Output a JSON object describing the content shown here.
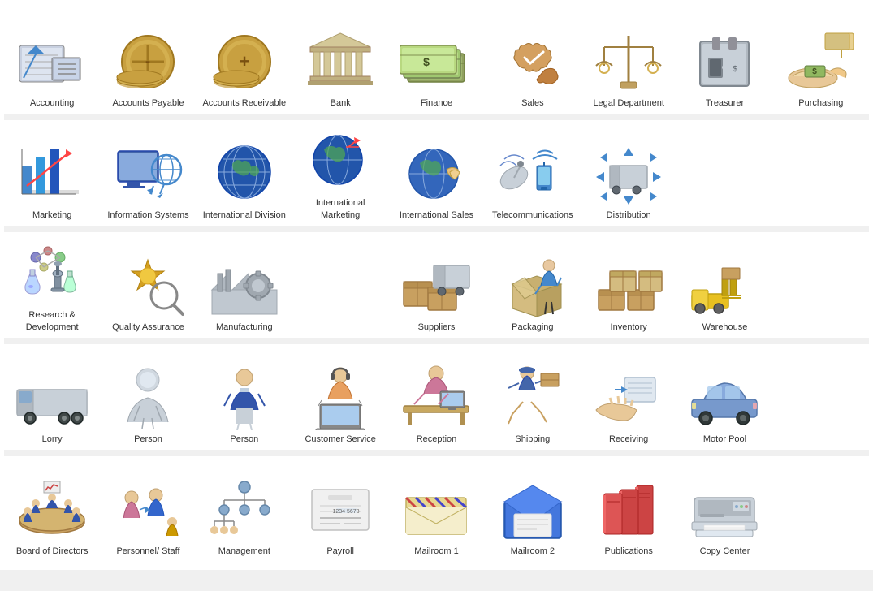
{
  "items": [
    {
      "id": "accounting",
      "label": "Accounting",
      "row": 1
    },
    {
      "id": "accounts-payable",
      "label": "Accounts Payable",
      "row": 1
    },
    {
      "id": "accounts-receivable",
      "label": "Accounts Receivable",
      "row": 1
    },
    {
      "id": "bank",
      "label": "Bank",
      "row": 1
    },
    {
      "id": "finance",
      "label": "Finance",
      "row": 1
    },
    {
      "id": "sales",
      "label": "Sales",
      "row": 1
    },
    {
      "id": "legal-department",
      "label": "Legal Department",
      "row": 1
    },
    {
      "id": "treasurer",
      "label": "Treasurer",
      "row": 1
    },
    {
      "id": "purchasing",
      "label": "Purchasing",
      "row": 1
    },
    {
      "id": "marketing",
      "label": "Marketing",
      "row": 2
    },
    {
      "id": "information-systems",
      "label": "Information Systems",
      "row": 2
    },
    {
      "id": "international-division",
      "label": "International Division",
      "row": 2
    },
    {
      "id": "international-marketing",
      "label": "International Marketing",
      "row": 2
    },
    {
      "id": "international-sales",
      "label": "International Sales",
      "row": 2
    },
    {
      "id": "telecommunications",
      "label": "Telecommunications",
      "row": 2
    },
    {
      "id": "distribution",
      "label": "Distribution",
      "row": 2
    },
    {
      "id": "empty1",
      "label": "",
      "row": 2
    },
    {
      "id": "empty2",
      "label": "",
      "row": 2
    },
    {
      "id": "research-development",
      "label": "Research & Development",
      "row": 3
    },
    {
      "id": "quality-assurance",
      "label": "Quality Assurance",
      "row": 3
    },
    {
      "id": "manufacturing",
      "label": "Manufacturing",
      "row": 3
    },
    {
      "id": "empty3",
      "label": "",
      "row": 3
    },
    {
      "id": "suppliers",
      "label": "Suppliers",
      "row": 3
    },
    {
      "id": "packaging",
      "label": "Packaging",
      "row": 3
    },
    {
      "id": "inventory",
      "label": "Inventory",
      "row": 3
    },
    {
      "id": "warehouse",
      "label": "Warehouse",
      "row": 3
    },
    {
      "id": "empty4",
      "label": "",
      "row": 3
    },
    {
      "id": "lorry",
      "label": "Lorry",
      "row": 4
    },
    {
      "id": "person1",
      "label": "Person",
      "row": 4
    },
    {
      "id": "person2",
      "label": "Person",
      "row": 4
    },
    {
      "id": "customer-service",
      "label": "Customer Service",
      "row": 4
    },
    {
      "id": "reception",
      "label": "Reception",
      "row": 4
    },
    {
      "id": "shipping",
      "label": "Shipping",
      "row": 4
    },
    {
      "id": "receiving",
      "label": "Receiving",
      "row": 4
    },
    {
      "id": "motor-pool",
      "label": "Motor Pool",
      "row": 4
    },
    {
      "id": "empty5",
      "label": "",
      "row": 4
    },
    {
      "id": "board-of-directors",
      "label": "Board of Directors",
      "row": 5
    },
    {
      "id": "personnel-staff",
      "label": "Personnel/ Staff",
      "row": 5
    },
    {
      "id": "management",
      "label": "Management",
      "row": 5
    },
    {
      "id": "payroll",
      "label": "Payroll",
      "row": 5
    },
    {
      "id": "mailroom1",
      "label": "Mailroom 1",
      "row": 5
    },
    {
      "id": "mailroom2",
      "label": "Mailroom 2",
      "row": 5
    },
    {
      "id": "publications",
      "label": "Publications",
      "row": 5
    },
    {
      "id": "copy-center",
      "label": "Copy Center",
      "row": 5
    },
    {
      "id": "empty6",
      "label": "",
      "row": 5
    }
  ]
}
